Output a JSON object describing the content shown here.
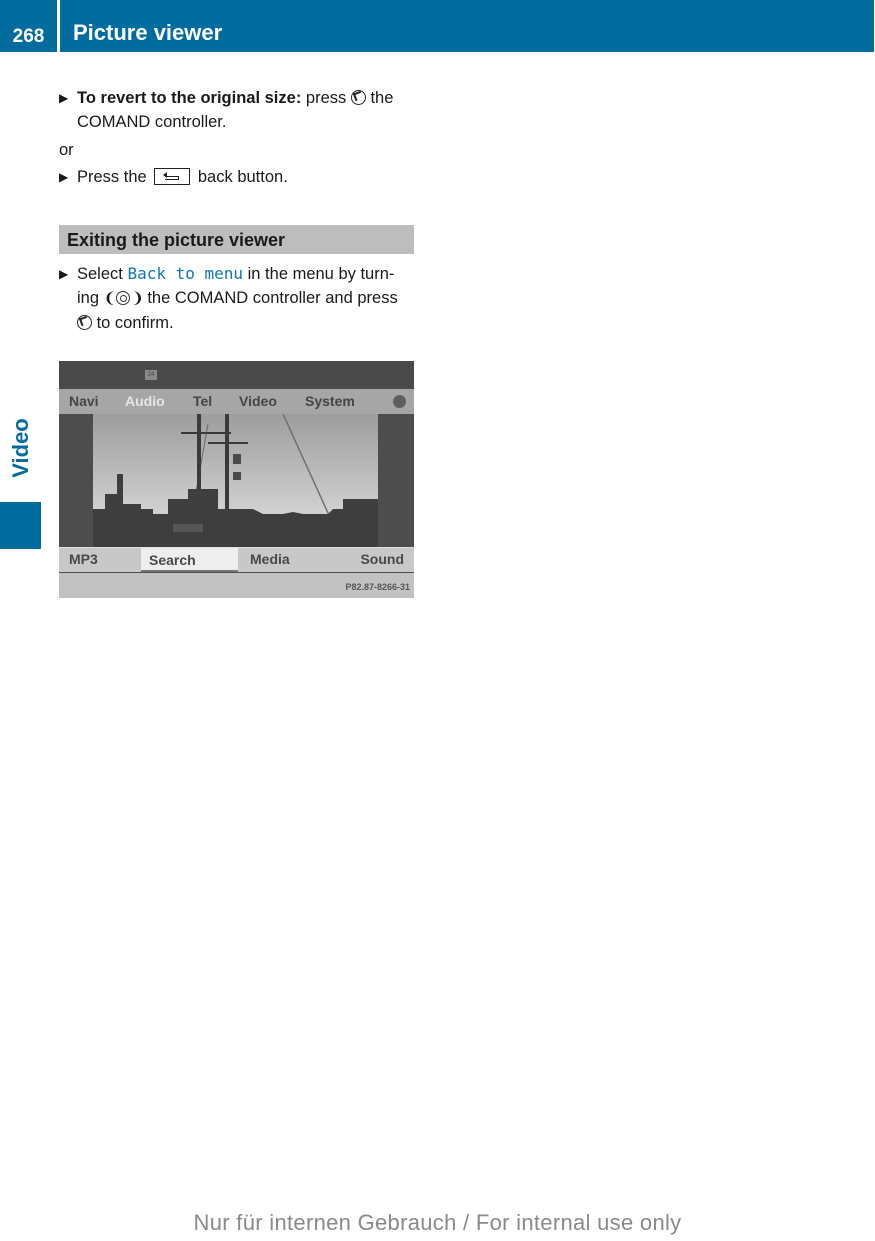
{
  "header": {
    "page_number": "268",
    "title": "Picture viewer",
    "accent_color": "#026c9e"
  },
  "side_tab": {
    "label": "Video"
  },
  "content": {
    "step1": {
      "bold_lead": "To revert to the original size:",
      "text_before_icon": " press ",
      "icon": "press-controller-icon",
      "text_after_icon": " the COMAND controller."
    },
    "or_text": "or",
    "step2": {
      "text_before_icon": "Press the ",
      "icon": "back-button-icon",
      "text_after_icon": " back button."
    },
    "section_heading": "Exiting the picture viewer",
    "step3": {
      "text_before_ref": "Select ",
      "menu_ref": "Back to menu",
      "text_after_ref": " in the menu by turn-ing ",
      "icon_rotate": "rotate-controller-icon",
      "text_after_rotate": " the COMAND controller and press ",
      "icon_press": "press-controller-icon",
      "text_end": " to confirm."
    }
  },
  "screen": {
    "main_menu": [
      {
        "label": "Navi",
        "active": false
      },
      {
        "label": "Audio",
        "active": true
      },
      {
        "label": "Tel",
        "active": false
      },
      {
        "label": "Video",
        "active": false
      },
      {
        "label": "System",
        "active": false
      }
    ],
    "sub_menu": [
      {
        "label": "MP3",
        "selected": false
      },
      {
        "label": "Search",
        "selected": true
      },
      {
        "label": "Media",
        "selected": false
      },
      {
        "label": "Sound",
        "selected": false
      }
    ],
    "image_code": "P82.87-8266-31"
  },
  "footer": {
    "watermark": "Nur für internen Gebrauch / For internal use only"
  }
}
